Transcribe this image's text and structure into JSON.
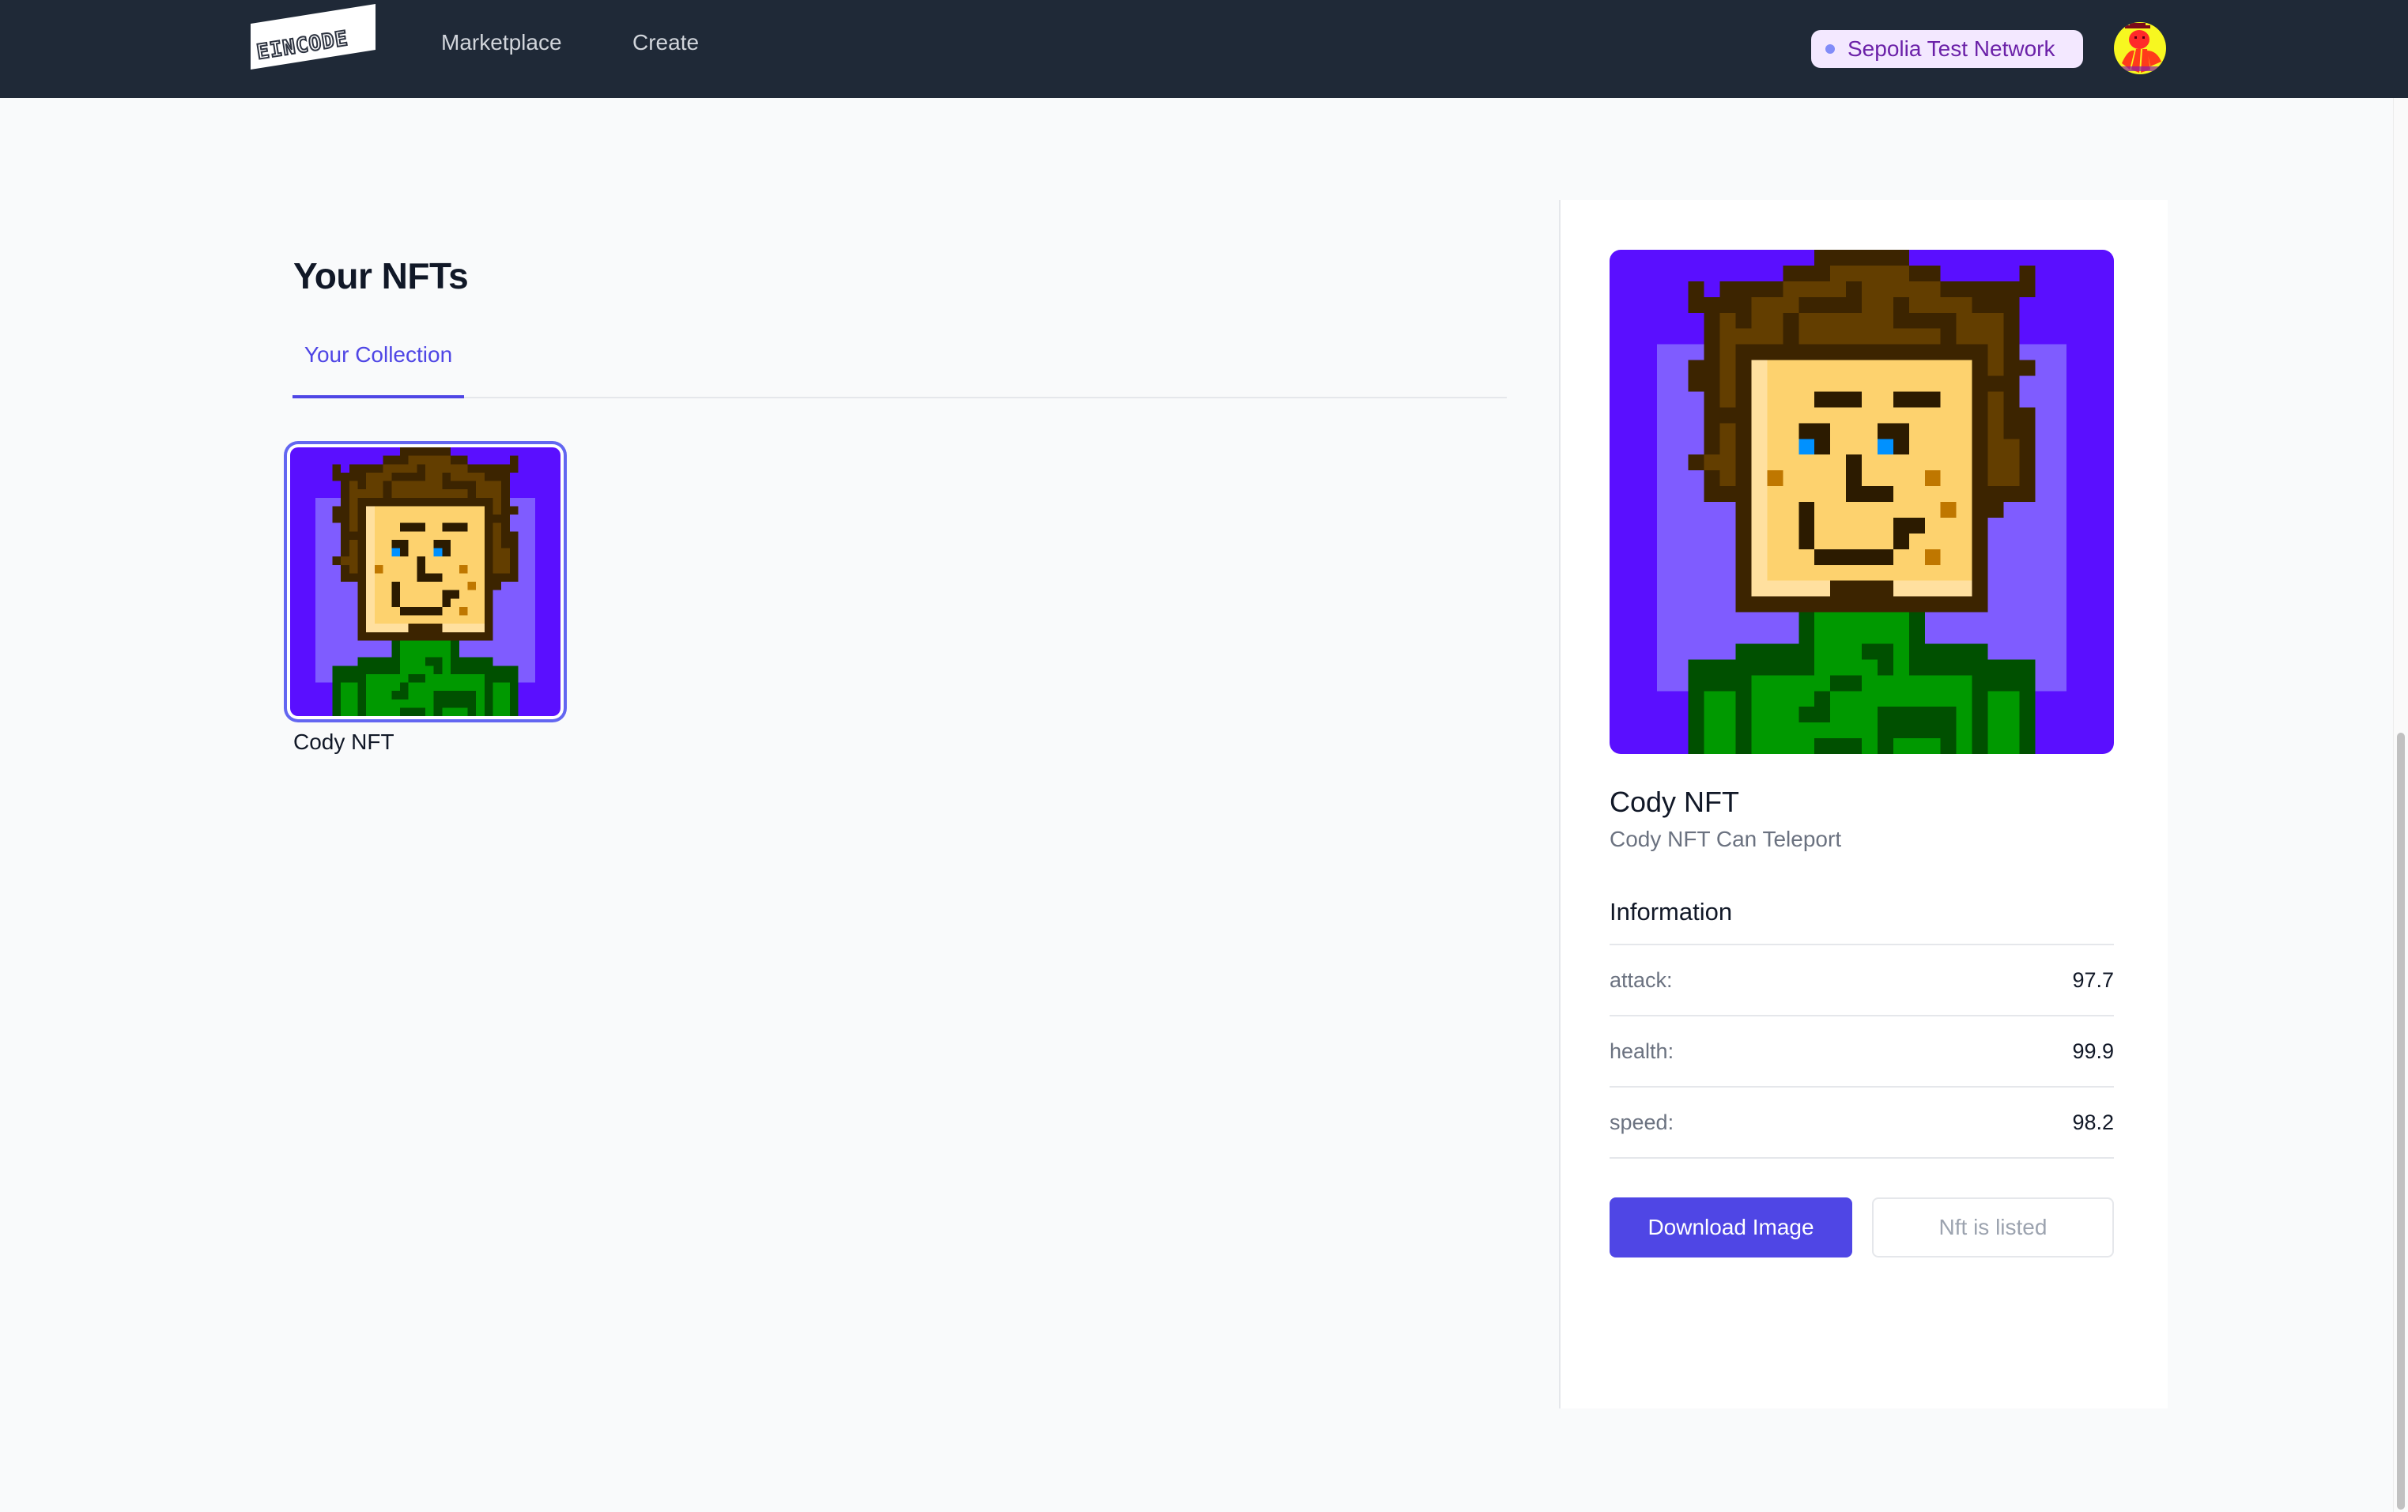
{
  "nav": {
    "logo_text": "EINCODE",
    "links": [
      {
        "label": "Marketplace"
      },
      {
        "label": "Create"
      }
    ],
    "network_badge": {
      "label": "Sepolia Test Network",
      "dot_color": "#818cf8"
    }
  },
  "main": {
    "title": "Your NFTs",
    "tabs": [
      {
        "label": "Your Collection",
        "active": true
      }
    ],
    "collection": [
      {
        "name": "Cody NFT",
        "selected": true
      }
    ]
  },
  "detail": {
    "name": "Cody NFT",
    "description": "Cody NFT Can Teleport",
    "info_heading": "Information",
    "attributes": [
      {
        "key": "attack:",
        "value": "97.7"
      },
      {
        "key": "health:",
        "value": "99.9"
      },
      {
        "key": "speed:",
        "value": "98.2"
      }
    ],
    "download_label": "Download Image",
    "listed_label": "Nft is listed"
  },
  "colors": {
    "accent": "#4f46e5",
    "nav_bg": "#1f2937",
    "badge_text": "#6b21a8"
  }
}
